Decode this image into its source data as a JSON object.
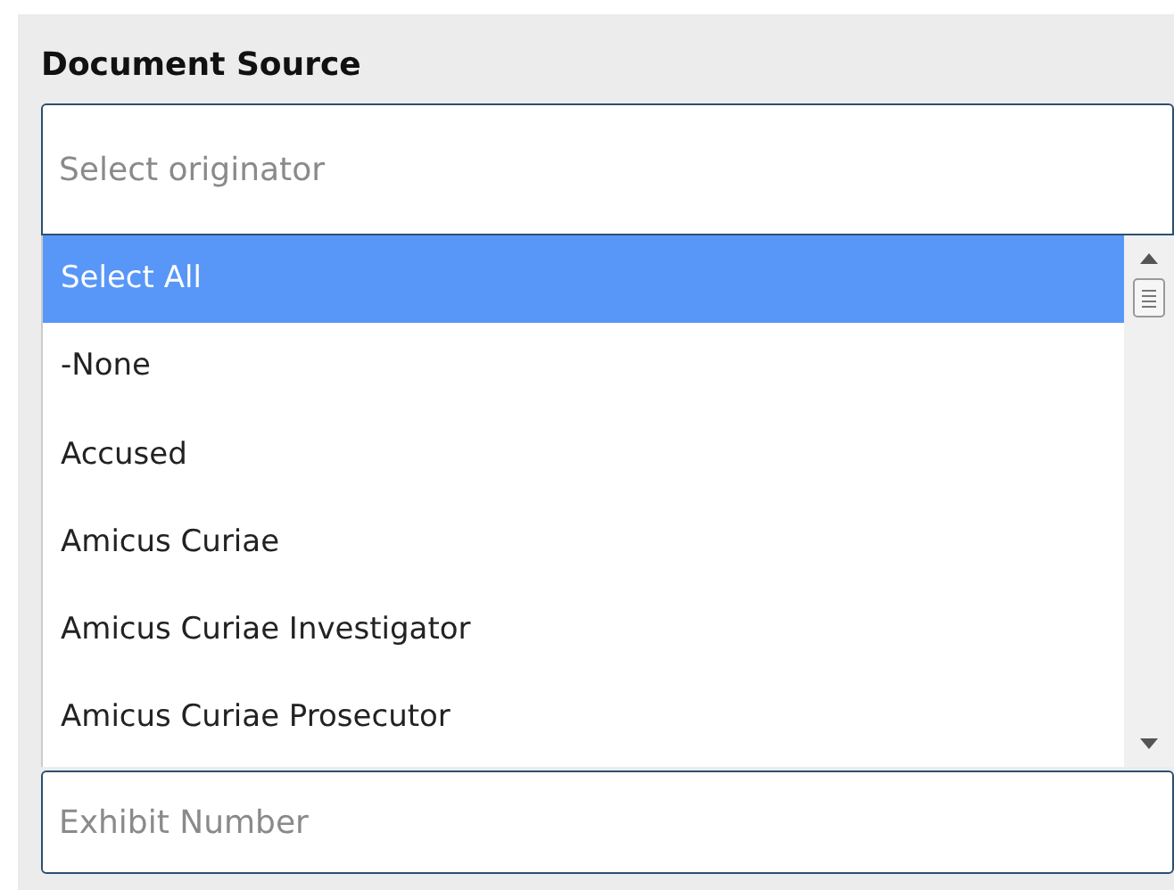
{
  "section": {
    "title": "Document Source"
  },
  "originator_field": {
    "placeholder": "Select originator"
  },
  "options": [
    {
      "label": "Select All",
      "selected": true
    },
    {
      "label": "-None",
      "selected": false
    },
    {
      "label": "Accused",
      "selected": false
    },
    {
      "label": "Amicus Curiae",
      "selected": false
    },
    {
      "label": "Amicus Curiae Investigator",
      "selected": false
    },
    {
      "label": "Amicus Curiae Prosecutor",
      "selected": false
    }
  ],
  "exhibit_field": {
    "placeholder": "Exhibit Number"
  }
}
